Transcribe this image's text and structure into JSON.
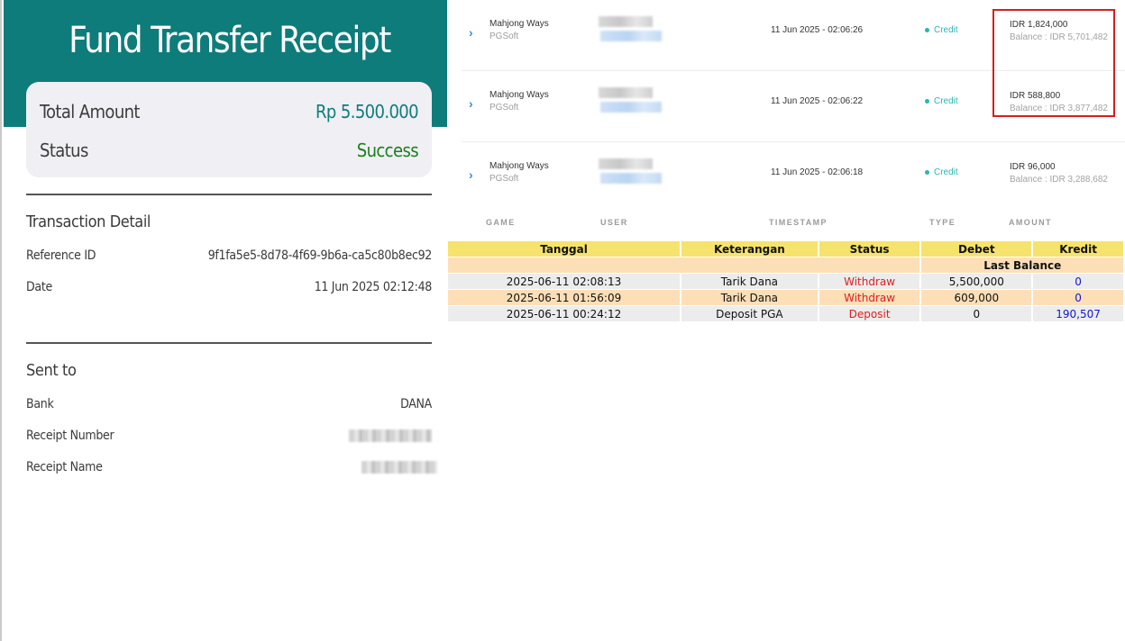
{
  "receipt": {
    "title": "Fund Transfer Receipt",
    "total_amount_label": "Total Amount",
    "total_amount_value": "Rp 5.500.000",
    "status_label": "Status",
    "status_value": "Success",
    "transaction_detail_title": "Transaction Detail",
    "reference_id_label": "Reference ID",
    "reference_id_value": "9f1fa5e5-8d78-4f69-9b6a-ca5c80b8ec92",
    "date_label": "Date",
    "date_value": "11 Jun 2025 02:12:48",
    "sent_to_title": "Sent to",
    "bank_label": "Bank",
    "bank_value": "DANA",
    "receipt_number_label": "Receipt Number",
    "receipt_name_label": "Receipt Name",
    "colors": {
      "header": "#0e7c7b",
      "amount": "#0e7c7b",
      "success": "#1a7f1a"
    }
  },
  "history": {
    "rows": [
      {
        "game": "Mahjong Ways",
        "provider": "PGSoft",
        "timestamp": "11 Jun 2025 - 02:06:26",
        "type": "Credit",
        "amount": "IDR 1,824,000",
        "balance": "Balance : IDR 5,701,482"
      },
      {
        "game": "Mahjong Ways",
        "provider": "PGSoft",
        "timestamp": "11 Jun 2025 - 02:06:22",
        "type": "Credit",
        "amount": "IDR 588,800",
        "balance": "Balance : IDR 3,877,482"
      },
      {
        "game": "Mahjong Ways",
        "provider": "PGSoft",
        "timestamp": "11 Jun 2025 - 02:06:18",
        "type": "Credit",
        "amount": "IDR 96,000",
        "balance": "Balance : IDR 3,288,682"
      }
    ],
    "columns": {
      "game": "GAME",
      "user": "USER",
      "timestamp": "TIMESTAMP",
      "type": "TYPE",
      "amount": "AMOUNT"
    },
    "highlight_color": "#d81e1e"
  },
  "ledger": {
    "headers": {
      "tanggal": "Tanggal",
      "keterangan": "Keterangan",
      "status": "Status",
      "debet": "Debet",
      "kredit": "Kredit"
    },
    "last_balance_label": "Last Balance",
    "rows": [
      {
        "tanggal": "2025-06-11 02:08:13",
        "keterangan": "Tarik Dana",
        "status": "Withdraw",
        "debet": "5,500,000",
        "kredit": "0"
      },
      {
        "tanggal": "2025-06-11 01:56:09",
        "keterangan": "Tarik Dana",
        "status": "Withdraw",
        "debet": "609,000",
        "kredit": "0"
      },
      {
        "tanggal": "2025-06-11 00:24:12",
        "keterangan": "Deposit PGA",
        "status": "Deposit",
        "debet": "0",
        "kredit": "190,507"
      }
    ]
  }
}
